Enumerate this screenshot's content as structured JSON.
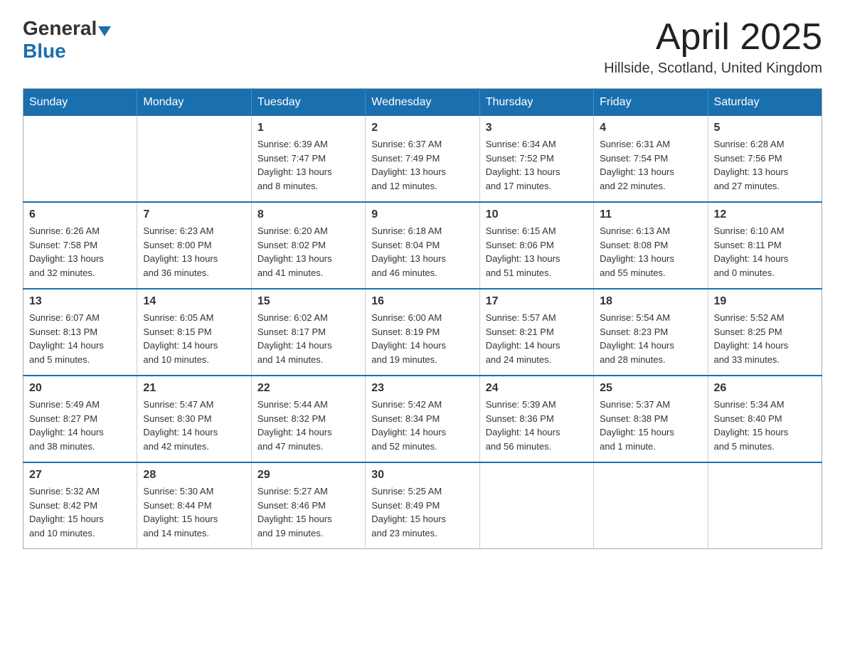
{
  "logo": {
    "text_general": "General",
    "text_blue": "Blue",
    "arrow_label": "logo-arrow"
  },
  "header": {
    "month_year": "April 2025",
    "location": "Hillside, Scotland, United Kingdom"
  },
  "weekdays": [
    "Sunday",
    "Monday",
    "Tuesday",
    "Wednesday",
    "Thursday",
    "Friday",
    "Saturday"
  ],
  "weeks": [
    [
      {
        "day": "",
        "info": ""
      },
      {
        "day": "",
        "info": ""
      },
      {
        "day": "1",
        "info": "Sunrise: 6:39 AM\nSunset: 7:47 PM\nDaylight: 13 hours\nand 8 minutes."
      },
      {
        "day": "2",
        "info": "Sunrise: 6:37 AM\nSunset: 7:49 PM\nDaylight: 13 hours\nand 12 minutes."
      },
      {
        "day": "3",
        "info": "Sunrise: 6:34 AM\nSunset: 7:52 PM\nDaylight: 13 hours\nand 17 minutes."
      },
      {
        "day": "4",
        "info": "Sunrise: 6:31 AM\nSunset: 7:54 PM\nDaylight: 13 hours\nand 22 minutes."
      },
      {
        "day": "5",
        "info": "Sunrise: 6:28 AM\nSunset: 7:56 PM\nDaylight: 13 hours\nand 27 minutes."
      }
    ],
    [
      {
        "day": "6",
        "info": "Sunrise: 6:26 AM\nSunset: 7:58 PM\nDaylight: 13 hours\nand 32 minutes."
      },
      {
        "day": "7",
        "info": "Sunrise: 6:23 AM\nSunset: 8:00 PM\nDaylight: 13 hours\nand 36 minutes."
      },
      {
        "day": "8",
        "info": "Sunrise: 6:20 AM\nSunset: 8:02 PM\nDaylight: 13 hours\nand 41 minutes."
      },
      {
        "day": "9",
        "info": "Sunrise: 6:18 AM\nSunset: 8:04 PM\nDaylight: 13 hours\nand 46 minutes."
      },
      {
        "day": "10",
        "info": "Sunrise: 6:15 AM\nSunset: 8:06 PM\nDaylight: 13 hours\nand 51 minutes."
      },
      {
        "day": "11",
        "info": "Sunrise: 6:13 AM\nSunset: 8:08 PM\nDaylight: 13 hours\nand 55 minutes."
      },
      {
        "day": "12",
        "info": "Sunrise: 6:10 AM\nSunset: 8:11 PM\nDaylight: 14 hours\nand 0 minutes."
      }
    ],
    [
      {
        "day": "13",
        "info": "Sunrise: 6:07 AM\nSunset: 8:13 PM\nDaylight: 14 hours\nand 5 minutes."
      },
      {
        "day": "14",
        "info": "Sunrise: 6:05 AM\nSunset: 8:15 PM\nDaylight: 14 hours\nand 10 minutes."
      },
      {
        "day": "15",
        "info": "Sunrise: 6:02 AM\nSunset: 8:17 PM\nDaylight: 14 hours\nand 14 minutes."
      },
      {
        "day": "16",
        "info": "Sunrise: 6:00 AM\nSunset: 8:19 PM\nDaylight: 14 hours\nand 19 minutes."
      },
      {
        "day": "17",
        "info": "Sunrise: 5:57 AM\nSunset: 8:21 PM\nDaylight: 14 hours\nand 24 minutes."
      },
      {
        "day": "18",
        "info": "Sunrise: 5:54 AM\nSunset: 8:23 PM\nDaylight: 14 hours\nand 28 minutes."
      },
      {
        "day": "19",
        "info": "Sunrise: 5:52 AM\nSunset: 8:25 PM\nDaylight: 14 hours\nand 33 minutes."
      }
    ],
    [
      {
        "day": "20",
        "info": "Sunrise: 5:49 AM\nSunset: 8:27 PM\nDaylight: 14 hours\nand 38 minutes."
      },
      {
        "day": "21",
        "info": "Sunrise: 5:47 AM\nSunset: 8:30 PM\nDaylight: 14 hours\nand 42 minutes."
      },
      {
        "day": "22",
        "info": "Sunrise: 5:44 AM\nSunset: 8:32 PM\nDaylight: 14 hours\nand 47 minutes."
      },
      {
        "day": "23",
        "info": "Sunrise: 5:42 AM\nSunset: 8:34 PM\nDaylight: 14 hours\nand 52 minutes."
      },
      {
        "day": "24",
        "info": "Sunrise: 5:39 AM\nSunset: 8:36 PM\nDaylight: 14 hours\nand 56 minutes."
      },
      {
        "day": "25",
        "info": "Sunrise: 5:37 AM\nSunset: 8:38 PM\nDaylight: 15 hours\nand 1 minute."
      },
      {
        "day": "26",
        "info": "Sunrise: 5:34 AM\nSunset: 8:40 PM\nDaylight: 15 hours\nand 5 minutes."
      }
    ],
    [
      {
        "day": "27",
        "info": "Sunrise: 5:32 AM\nSunset: 8:42 PM\nDaylight: 15 hours\nand 10 minutes."
      },
      {
        "day": "28",
        "info": "Sunrise: 5:30 AM\nSunset: 8:44 PM\nDaylight: 15 hours\nand 14 minutes."
      },
      {
        "day": "29",
        "info": "Sunrise: 5:27 AM\nSunset: 8:46 PM\nDaylight: 15 hours\nand 19 minutes."
      },
      {
        "day": "30",
        "info": "Sunrise: 5:25 AM\nSunset: 8:49 PM\nDaylight: 15 hours\nand 23 minutes."
      },
      {
        "day": "",
        "info": ""
      },
      {
        "day": "",
        "info": ""
      },
      {
        "day": "",
        "info": ""
      }
    ]
  ]
}
